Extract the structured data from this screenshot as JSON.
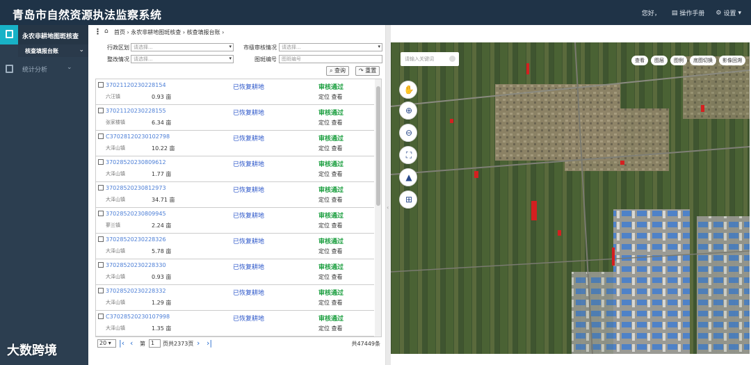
{
  "header": {
    "title": "青岛市自然资源执法监察系统",
    "greeting": "您好，",
    "manual": "操作手册",
    "settings": "设置"
  },
  "sidebar": {
    "active_group": "永农非耕地图斑核查",
    "active_sub": "核查填报台账",
    "items": [
      {
        "label": "统计分析"
      }
    ]
  },
  "breadcrumb": "首页 › 永农非耕地图斑核查 › 核查填报台账 ›",
  "filters": {
    "region_label": "行政区划",
    "region_placeholder": "请选择...",
    "city_audit_label": "市级审核情况",
    "city_audit_placeholder": "请选择...",
    "rectify_label": "整改情况",
    "rectify_placeholder": "请选择...",
    "patch_no_label": "图斑编号",
    "patch_no_placeholder": "图斑编号",
    "search_label": "查询",
    "reset_label": "重置"
  },
  "list": {
    "rows": [
      {
        "code": "37021120230228154",
        "owner": "六汪镇",
        "area": "0.93 亩",
        "status": "已恢复耕地",
        "audit": "审核通过",
        "actions": "定位 查看"
      },
      {
        "code": "37021120230228155",
        "owner": "张家楼镇",
        "area": "6.34 亩",
        "status": "已恢复耕地",
        "audit": "审核通过",
        "actions": "定位 查看"
      },
      {
        "code": "C37028120230102798",
        "owner": "大泽山镇",
        "area": "10.22 亩",
        "status": "已恢复耕地",
        "audit": "审核通过",
        "actions": "定位 查看"
      },
      {
        "code": "37028520230809612",
        "owner": "大泽山镇",
        "area": "1.77 亩",
        "status": "已恢复耕地",
        "audit": "审核通过",
        "actions": "定位 查看"
      },
      {
        "code": "37028520230812973",
        "owner": "大泽山镇",
        "area": "34.71 亩",
        "status": "已恢复耕地",
        "audit": "审核通过",
        "actions": "定位 查看"
      },
      {
        "code": "37028520230809945",
        "owner": "蓼兰镇",
        "area": "2.24 亩",
        "status": "已恢复耕地",
        "audit": "审核通过",
        "actions": "定位 查看"
      },
      {
        "code": "37028520230228326",
        "owner": "大泽山镇",
        "area": "5.78 亩",
        "status": "已恢复耕地",
        "audit": "审核通过",
        "actions": "定位 查看"
      },
      {
        "code": "37028520230228330",
        "owner": "大泽山镇",
        "area": "0.93 亩",
        "status": "已恢复耕地",
        "audit": "审核通过",
        "actions": "定位 查看"
      },
      {
        "code": "37028520230228332",
        "owner": "大泽山镇",
        "area": "1.29 亩",
        "status": "已恢复耕地",
        "audit": "审核通过",
        "actions": "定位 查看"
      },
      {
        "code": "C37028520230107998",
        "owner": "大泽山镇",
        "area": "1.35 亩",
        "status": "已恢复耕地",
        "audit": "审核通过",
        "actions": "定位 查看"
      }
    ]
  },
  "pager": {
    "page_size": "20",
    "page_prefix": "第",
    "current_page": "1",
    "page_suffix": "页共2373页",
    "total": "共47449条"
  },
  "map": {
    "search_placeholder": "请输入关键词",
    "tools": [
      "查看",
      "图层",
      "图例",
      "底图切换",
      "影像回溯"
    ],
    "controls": [
      {
        "name": "pan-icon",
        "glyph": "✋"
      },
      {
        "name": "zoom-in-icon",
        "glyph": "⊕"
      },
      {
        "name": "zoom-out-icon",
        "glyph": "⊖"
      },
      {
        "name": "fullscreen-icon",
        "glyph": "⛶"
      },
      {
        "name": "locate-icon",
        "glyph": "▲"
      },
      {
        "name": "split-icon",
        "glyph": "⊞"
      }
    ]
  },
  "watermark": "大数跨境",
  "colors": {
    "topbar": "#1f3347",
    "sidebar": "#2c3e50",
    "accent": "#18b2c7",
    "link": "#4a7dd6",
    "status": "#2b56c9",
    "audit_ok": "#1a9e3e"
  }
}
